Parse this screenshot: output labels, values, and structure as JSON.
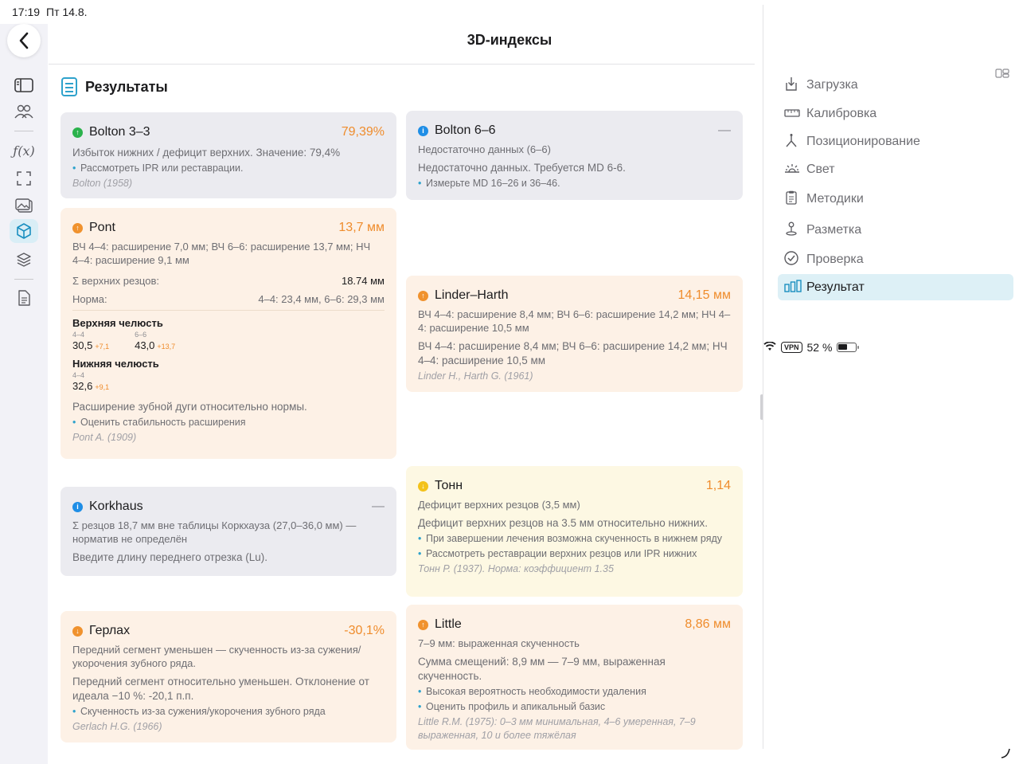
{
  "status": {
    "time": "17:19",
    "date": "Пт 14.8.",
    "vpn": "VPN",
    "battery": "52 %"
  },
  "page_title": "3D-индексы",
  "results_title": "Результаты",
  "cards": {
    "bolton33": {
      "title": "Bolton 3–3",
      "value": "79,39%",
      "sub": "Избыток нижних / дефицит верхних. Значение: 79,4%",
      "bullet": "Рассмотреть IPR или реставрации.",
      "ref": "Bolton (1958)"
    },
    "bolton66": {
      "title": "Bolton 6–6",
      "value": "—",
      "sub": "Недостаточно данных (6–6)",
      "body": "Недостаточно данных. Требуется MD 6-6.",
      "bullet": "Измерьте MD 16–26 и 36–46.",
      "ref": ""
    },
    "pont": {
      "title": "Pont",
      "value": "13,7 мм",
      "sub": "ВЧ 4–4: расширение 7,0 мм; ВЧ 6–6: расширение 13,7 мм; НЧ 4–4: расширение 9,1 мм",
      "sum_label": "Σ верхних резцов:",
      "sum_value": "18.74 мм",
      "norm_label": "Норма:",
      "norm_value": "4–4: 23,4 мм, 6–6: 29,3 мм",
      "upper_title": "Верхняя челюсть",
      "upper": [
        {
          "label": "4–4",
          "value": "30,5",
          "delta": "+7,1"
        },
        {
          "label": "6–6",
          "value": "43,0",
          "delta": "+13,7"
        }
      ],
      "lower_title": "Нижняя челюсть",
      "lower": [
        {
          "label": "4–4",
          "value": "32,6",
          "delta": "+9,1"
        }
      ],
      "body": "Расширение зубной дуги относительно нормы.",
      "bullet": "Оценить стабильность расширения",
      "ref": "Pont A. (1909)"
    },
    "linder": {
      "title": "Linder–Harth",
      "value": "14,15 мм",
      "sub": "ВЧ 4–4: расширение 8,4 мм; ВЧ 6–6: расширение 14,2 мм; НЧ 4–4: расширение 10,5 мм",
      "body": "ВЧ 4–4: расширение 8,4 мм; ВЧ 6–6: расширение 14,2 мм; НЧ 4–4: расширение 10,5 мм",
      "ref": "Linder H., Harth G. (1961)"
    },
    "korkhaus": {
      "title": "Korkhaus",
      "value": "—",
      "sub": "Σ резцов 18,7 мм вне таблицы Коркхауза (27,0–36,0 мм) — норматив не определён",
      "body": "Введите длину переднего отрезка (Lu)."
    },
    "tonn": {
      "title": "Тонн",
      "value": "1,14",
      "sub": "Дефицит верхних резцов (3,5 мм)",
      "body": "Дефицит верхних резцов на 3.5 мм относительно нижних.",
      "bullet1": "При завершении лечения возможна скученность в нижнем ряду",
      "bullet2": "Рассмотреть реставрации верхних резцов или IPR нижних",
      "ref": "Тонн Р. (1937). Норма: коэффициент 1.35"
    },
    "gerlach": {
      "title": "Герлах",
      "value": "-30,1%",
      "sub": "Передний сегмент уменьшен — скученность из-за сужения/укорочения зубного ряда.",
      "body": "Передний сегмент относительно уменьшен. Отклонение от идеала −10 %: -20,1 п.п.",
      "bullet": "Скученность из-за сужения/укорочения зубного ряда",
      "ref": "Gerlach H.G. (1966)"
    },
    "little": {
      "title": "Little",
      "value": "8,86 мм",
      "sub": "7–9 мм: выраженная скученность",
      "body": "Сумма смещений: 8,9 мм — 7–9 мм, выраженная скученность.",
      "bullet1": "Высокая вероятность необходимости удаления",
      "bullet2": "Оценить профиль и апикальный базис",
      "ref": "Little R.M. (1975): 0–3 мм минимальная, 4–6 умеренная, 7–9 выраженная, 10 и более тяжёлая"
    }
  },
  "nav": {
    "items": [
      {
        "label": "Загрузка",
        "icon": "download-icon"
      },
      {
        "label": "Калибровка",
        "icon": "ruler-icon"
      },
      {
        "label": "Позиционирование",
        "icon": "axes-icon"
      },
      {
        "label": "Свет",
        "icon": "light-icon"
      },
      {
        "label": "Методики",
        "icon": "clipboard-icon"
      },
      {
        "label": "Разметка",
        "icon": "pin-icon"
      },
      {
        "label": "Проверка",
        "icon": "check-circle-icon"
      },
      {
        "label": "Результат",
        "icon": "bar-chart-icon"
      }
    ]
  },
  "colors": {
    "accent": "#2ea2cc",
    "value_orange": "#ef8c2c",
    "active_bg": "#ddf0f6"
  }
}
